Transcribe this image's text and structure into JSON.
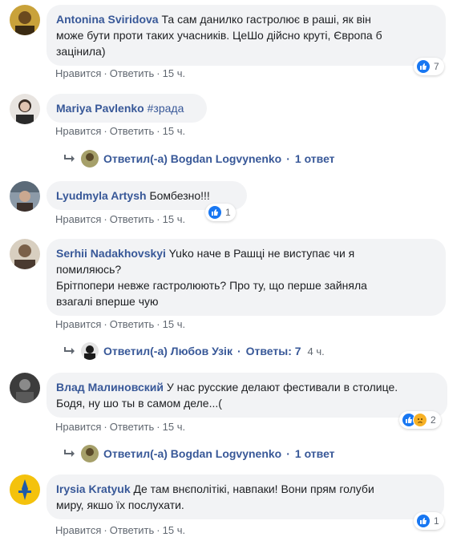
{
  "actions": {
    "like": "Нравится",
    "reply": "Ответить",
    "separator": "·"
  },
  "comments": [
    {
      "author": "Antonina Sviridova",
      "line1": "Та сам данилко гастролює в раші, як він",
      "line2": "може бути проти таких учасників. ЦеШо дійсно круті, Європа б",
      "line3": "зацінила)",
      "time": "15 ч.",
      "reaction_count": "7"
    },
    {
      "author": "Mariya Pavlenko",
      "hashtag": "#зрада",
      "time": "15 ч."
    },
    {
      "author": "Lyudmyla Artysh",
      "line1": "Бомбезно!!!",
      "time": "15 ч.",
      "reaction_count": "1"
    },
    {
      "author": "Serhii Nadakhovskyi",
      "line1": "Yuko наче в Рашці не виступає чи я",
      "line2": "помиляюсь?",
      "line3": "Брітпопери невже гастролюють? Про ту, що перше зайняла",
      "line4": "взагалі вперше чую",
      "time": "15 ч."
    },
    {
      "author": "Влад Малиновский",
      "line1": "У нас русские делают фестивали в столице.",
      "line2": "Бодя, ну шо ты в самом деле...(",
      "time": "15 ч.",
      "reaction_count": "2"
    },
    {
      "author": "Irysia Kratyuk",
      "line1": "Де там внєполітікі, навпаки! Вони прям голуби",
      "line2": "миру, якшо їх послухати.",
      "time": "15 ч.",
      "reaction_count": "1"
    }
  ],
  "replies": [
    {
      "text": "Ответил(-а) Bogdan Logvynenko",
      "count": "1 ответ"
    },
    {
      "text": "Ответил(-а) Любов Узік",
      "count": "Ответы: 7",
      "time": "4 ч."
    },
    {
      "text": "Ответил(-а) Bogdan Logvynenko",
      "count": "1 ответ"
    }
  ]
}
